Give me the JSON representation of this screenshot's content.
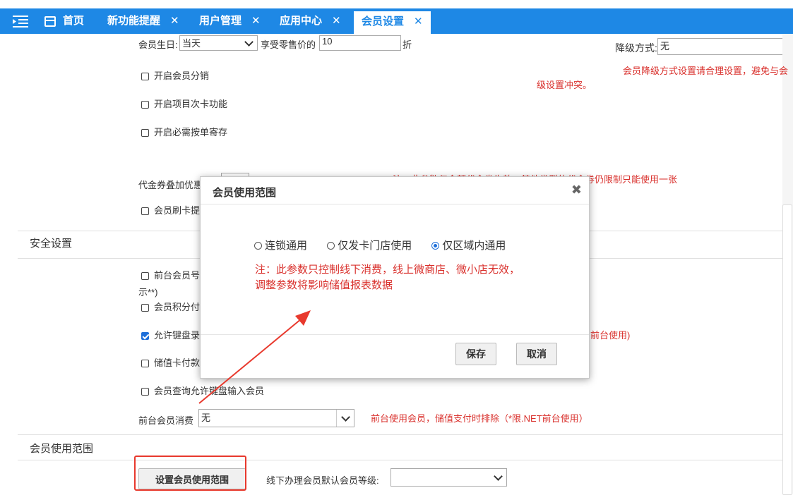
{
  "tabs": {
    "home": "首页",
    "items": [
      {
        "label": "新功能提醒",
        "close": "✕"
      },
      {
        "label": "用户管理",
        "close": "✕"
      },
      {
        "label": "应用中心",
        "close": "✕"
      },
      {
        "label": "会员设置",
        "close": "✕",
        "active": true
      }
    ]
  },
  "top_row": {
    "birthday_label": "会员生日:",
    "birthday_value": "当天",
    "discount_label": "享受零售价的",
    "discount_value": "10",
    "discount_unit": "折",
    "downgrade_label": "降级方式:",
    "downgrade_value": "无",
    "downgrade_note_1": "会员降级方式设置请合理设置，避免与会",
    "downgrade_note_2": "级设置冲突。"
  },
  "checkboxes": {
    "distribution": "开启会员分销",
    "project_card": "开启项目次卡功能",
    "storage": "开启必需按单寄存"
  },
  "coupon": {
    "label": "代金券叠加优惠",
    "note": "注：此参数仅金额代金券生效，其他类型的代金券仍限制只能使用一张"
  },
  "swipe_label": "会员刷卡提",
  "security": {
    "title": "安全设置",
    "front_member_label": "前台会员号",
    "front_member_cont": "示**)",
    "points_label": "会员积分付",
    "keyboard_label": "允许键盘录",
    "keyboard_note": "前台使用)",
    "stored_card_label": "储值卡付款",
    "query_label": "会员查询允许键盘输入会员",
    "consume_label": "前台会员消费",
    "consume_value": "无",
    "consume_note": "前台使用会员，储值支付时排除（*限.NET前台使用）"
  },
  "scope": {
    "title": "会员使用范围",
    "button": "设置会员使用范围",
    "default_level_label": "线下办理会员默认会员等级:"
  },
  "modal": {
    "title": "会员使用范围",
    "close": "✖",
    "options": [
      "连锁通用",
      "仅发卡门店使用",
      "仅区域内通用"
    ],
    "selected": 2,
    "note_1": "注：此参数只控制线下消费，线上微商店、微小店无效，",
    "note_2": "调整参数将影响储值报表数据",
    "save": "保存",
    "cancel": "取消"
  },
  "colors": {
    "tabbar": "#1e88e5",
    "note_red": "#d9302c",
    "highlight": "#e8392d"
  }
}
